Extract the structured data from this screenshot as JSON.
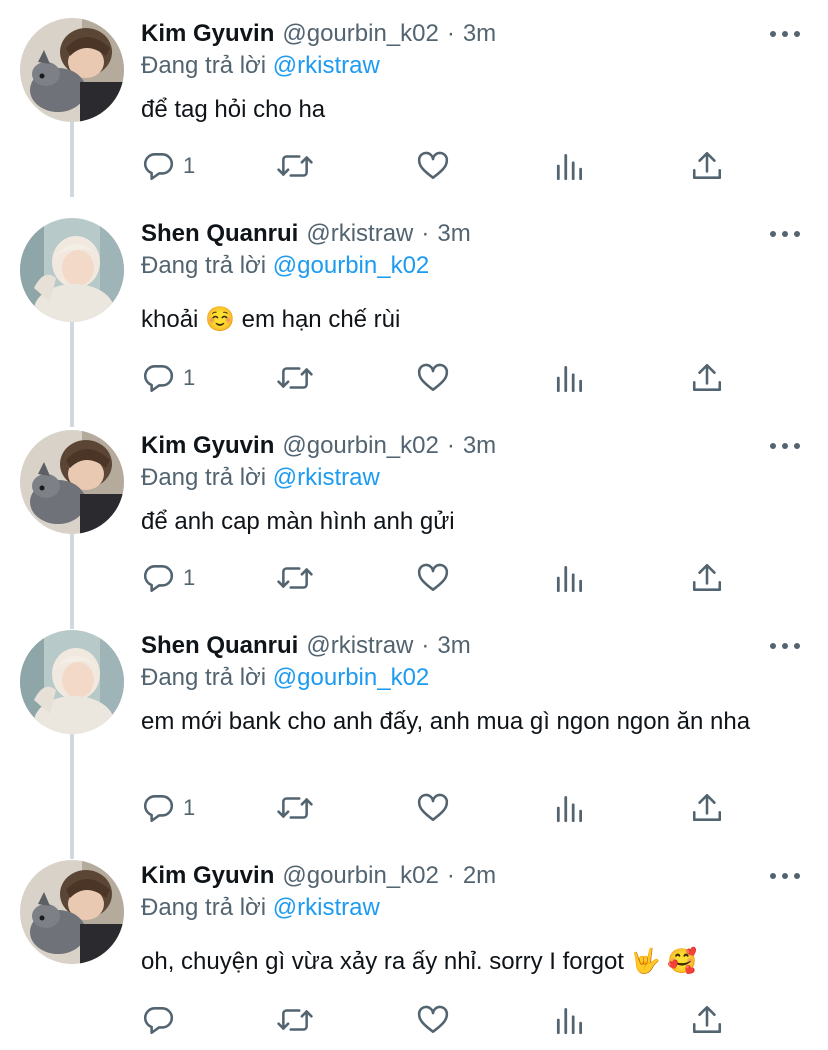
{
  "colors": {
    "text": "#0f1419",
    "muted": "#536471",
    "link": "#1d9bf0",
    "thread_line": "#cfd9de"
  },
  "icons": [
    "reply-icon",
    "retweet-icon",
    "like-icon",
    "views-icon",
    "share-icon",
    "more-icon"
  ],
  "tweets": [
    {
      "name": "Kim Gyuvin",
      "handle": "@gourbin_k02",
      "dot": "·",
      "time": "3m",
      "reply_prefix": "Đang trả lời",
      "reply_to": "@rkistraw",
      "text": "để tag hỏi cho ha",
      "reply_count": "1"
    },
    {
      "name": "Shen Quanrui",
      "handle": "@rkistraw",
      "dot": "·",
      "time": "3m",
      "reply_prefix": "Đang trả lời",
      "reply_to": "@gourbin_k02",
      "text": "khoải ☺️  em hạn chế rùi",
      "reply_count": "1"
    },
    {
      "name": "Kim Gyuvin",
      "handle": "@gourbin_k02",
      "dot": "·",
      "time": "3m",
      "reply_prefix": "Đang trả lời",
      "reply_to": "@rkistraw",
      "text": "để anh cap màn hình anh gửi",
      "reply_count": "1"
    },
    {
      "name": "Shen Quanrui",
      "handle": "@rkistraw",
      "dot": "·",
      "time": "3m",
      "reply_prefix": "Đang trả lời",
      "reply_to": "@gourbin_k02",
      "text": "em mới bank cho anh đấy, anh mua gì ngon ngon ăn nha",
      "reply_count": "1"
    },
    {
      "name": "Kim Gyuvin",
      "handle": "@gourbin_k02",
      "dot": "·",
      "time": "2m",
      "reply_prefix": "Đang trả lời",
      "reply_to": "@rkistraw",
      "text": "oh, chuyện gì vừa xảy ra ấy nhỉ. sorry I forgot 🤟 🥰",
      "reply_count": ""
    }
  ]
}
